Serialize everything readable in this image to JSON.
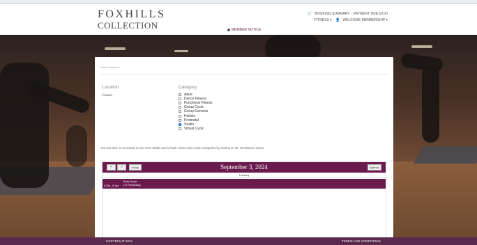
{
  "header": {
    "logo_line1": "FOXHILLS",
    "logo_line2": "COLLECTION",
    "booking_summary": "BOOKING SUMMARY",
    "payment_due": "PAYMENT DUE £0.00",
    "fitness_menu": "FITNESS ▾",
    "welcome_menu": "WELCOME MEMBERSHIP ▾",
    "member_notice": "MEMBER NOTICE"
  },
  "panel": {
    "breadcrumb": "Class Selection",
    "location_heading": "Location",
    "location_value": "Classes",
    "category_heading": "Category",
    "categories": [
      {
        "label": "Aqua",
        "checked": false
      },
      {
        "label": "Dance Fitness",
        "checked": false
      },
      {
        "label": "Functional Fitness",
        "checked": false
      },
      {
        "label": "Group Cycle",
        "checked": false
      },
      {
        "label": "Group Exercise",
        "checked": false
      },
      {
        "label": "Holistic",
        "checked": false
      },
      {
        "label": "Postnatal",
        "checked": false
      },
      {
        "label": "Studio",
        "checked": true
      },
      {
        "label": "Virtual Cycle",
        "checked": false
      }
    ],
    "hint": "You can click on an activity to see more details and to book. Show only certain categories by clicking on the checkboxes above."
  },
  "calendar": {
    "prev": "<",
    "next": ">",
    "today": "today",
    "agenda": "Agenda",
    "title": "September 3, 2024",
    "day": "Tuesday",
    "event": {
      "time": "8:30a - 9:15a",
      "title": "Body Sculpt",
      "remaining": "(17 Remaining)"
    }
  },
  "footer": {
    "copyright": "COPYRIGHT 2024",
    "terms": "TERMS AND CONDITIONS"
  },
  "colors": {
    "brand": "#6b1a4e",
    "footer": "#5a2a4e",
    "checkbox_on": "#2f7bd8"
  }
}
